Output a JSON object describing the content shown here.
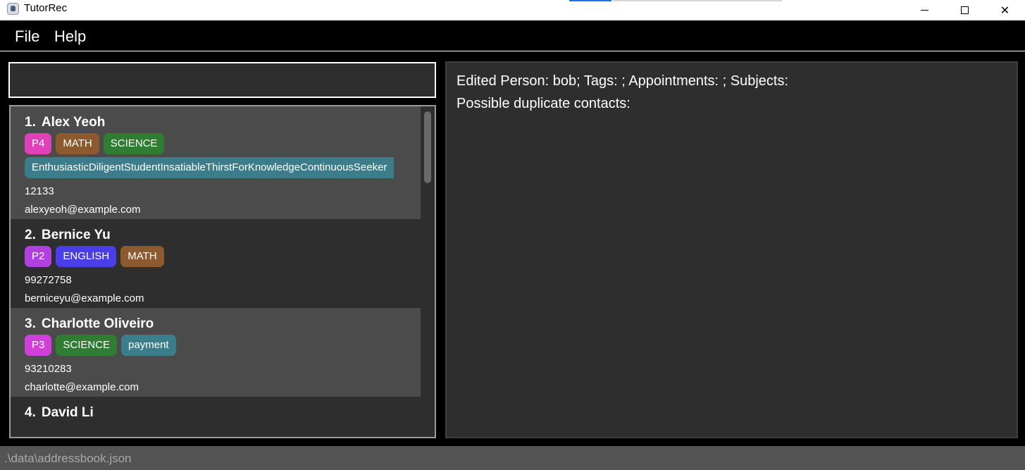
{
  "window": {
    "title": "TutorRec",
    "controls": {
      "minimize": "minimize-icon",
      "maximize": "maximize-icon",
      "close": "close-icon"
    }
  },
  "menu": {
    "items": [
      {
        "label": "File"
      },
      {
        "label": "Help"
      }
    ]
  },
  "command": {
    "value": "",
    "placeholder": ""
  },
  "persons": [
    {
      "index": "1.",
      "name": "Alex Yeoh",
      "tags": [
        {
          "label": "P4",
          "color": "#e040b8"
        },
        {
          "label": "MATH",
          "color": "#8c5a2e"
        },
        {
          "label": "SCIENCE",
          "color": "#2e7d32"
        }
      ],
      "note": {
        "label": "EnthusiasticDiligentStudentInsatiableThirstForKnowledgeContinuousSeeker",
        "color": "#3c7d8c"
      },
      "phone": "12133",
      "email": "alexyeoh@example.com"
    },
    {
      "index": "2.",
      "name": "Bernice Yu",
      "tags": [
        {
          "label": "P2",
          "color": "#b040e0"
        },
        {
          "label": "ENGLISH",
          "color": "#4a3ee8"
        },
        {
          "label": "MATH",
          "color": "#8c5a2e"
        }
      ],
      "phone": "99272758",
      "email": "berniceyu@example.com"
    },
    {
      "index": "3.",
      "name": "Charlotte Oliveiro",
      "tags": [
        {
          "label": "P3",
          "color": "#d040d8"
        },
        {
          "label": "SCIENCE",
          "color": "#2e7d32"
        },
        {
          "label": "payment",
          "color": "#3c7d8c"
        }
      ],
      "phone": "93210283",
      "email": "charlotte@example.com"
    },
    {
      "index": "4.",
      "name": "David Li"
    }
  ],
  "result": {
    "lines": [
      "Edited Person: bob; Tags: ; Appointments: ; Subjects:",
      "Possible duplicate contacts:"
    ]
  },
  "status": {
    "path": ".\\data\\addressbook.json"
  }
}
